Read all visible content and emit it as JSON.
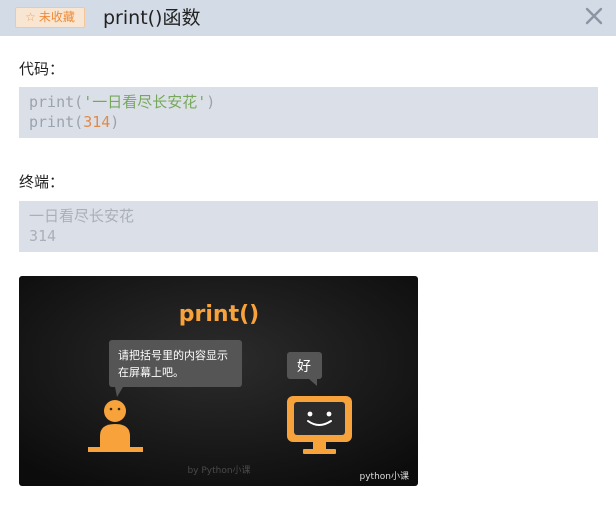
{
  "header": {
    "badge_label": "未收藏",
    "title": "print()函数"
  },
  "code_section": {
    "label": "代码：",
    "line1": {
      "func": "print(",
      "string": "'一日看尽长安花'",
      "close": ")"
    },
    "line2": {
      "func": "print(",
      "number": "314",
      "close": ")"
    }
  },
  "terminal_section": {
    "label": "终端：",
    "output": [
      "一日看尽长安花",
      "314"
    ]
  },
  "illustration": {
    "heading": "print()",
    "speech_left_line1": "请把括号里的内容显示",
    "speech_left_line2": "在屏幕上吧。",
    "speech_right": "好",
    "credit": "by Python小课",
    "watermark": "python小课",
    "colors": {
      "accent": "#f7a23b",
      "background": "#141414",
      "bubble": "#555555"
    }
  }
}
